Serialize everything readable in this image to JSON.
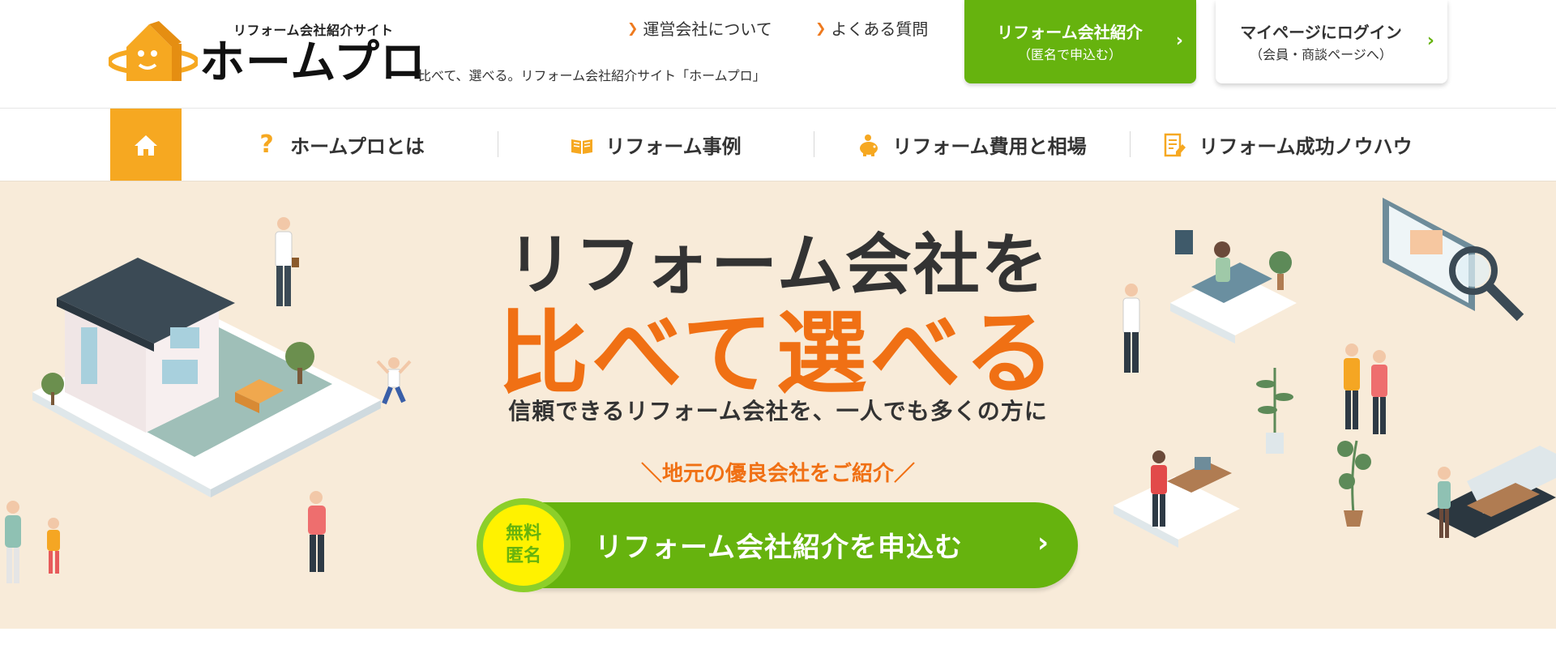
{
  "header": {
    "logo_caption": "リフォーム会社紹介サイト",
    "logo_name": "ホームプロ",
    "tagline": "比べて、選べる。リフォーム会社紹介サイト「ホームプロ」",
    "links": [
      {
        "label": "運営会社について"
      },
      {
        "label": "よくある質問"
      }
    ],
    "cta_primary": {
      "line1": "リフォーム会社紹介",
      "line2": "（匿名で申込む）"
    },
    "cta_login": {
      "line1": "マイページにログイン",
      "line2": "（会員・商談ページへ）"
    }
  },
  "nav": {
    "home_icon": "home-icon",
    "items": [
      {
        "label": "ホームプロとは",
        "icon": "question-icon"
      },
      {
        "label": "リフォーム事例",
        "icon": "book-icon"
      },
      {
        "label": "リフォーム費用と相場",
        "icon": "piggy-bank-icon"
      },
      {
        "label": "リフォーム成功ノウハウ",
        "icon": "document-pen-icon"
      }
    ]
  },
  "hero": {
    "title_line1": "リフォーム会社を",
    "title_line2": "比べて選べる",
    "subtitle": "信頼できるリフォーム会社を、一人でも多くの方に",
    "catch": "＼地元の優良会社をご紹介／",
    "cta": {
      "badge_line1": "無料",
      "badge_line2": "匿名",
      "label": "リフォーム会社紹介を申込む"
    }
  },
  "colors": {
    "accent_orange": "#f07014",
    "brand_green": "#66b30e",
    "home_orange": "#f6a821",
    "hero_bg": "#f8ebd9",
    "badge_yellow": "#fff200"
  }
}
